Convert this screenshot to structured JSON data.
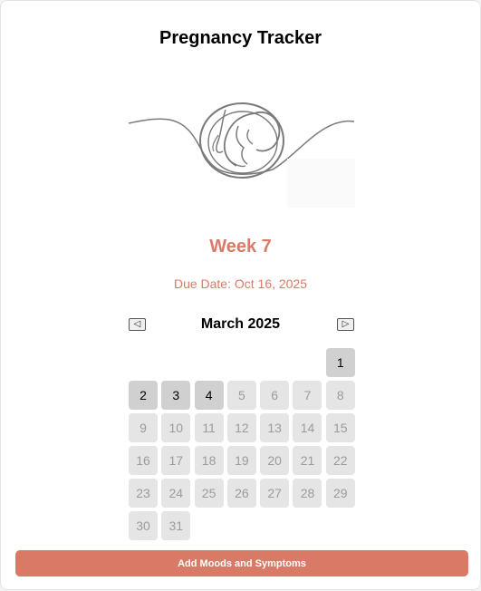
{
  "app": {
    "title": "Pregnancy Tracker"
  },
  "status": {
    "week_label": "Week 7",
    "due_date_label": "Due Date: Oct 16, 2025"
  },
  "calendar": {
    "month_label": "March 2025",
    "prev_icon": "triangle-left-icon",
    "next_icon": "triangle-right-icon",
    "leading_blanks": 6,
    "days": [
      {
        "label": "1",
        "active": true
      },
      {
        "label": "2",
        "active": true
      },
      {
        "label": "3",
        "active": true
      },
      {
        "label": "4",
        "active": true
      },
      {
        "label": "5",
        "active": false
      },
      {
        "label": "6",
        "active": false
      },
      {
        "label": "7",
        "active": false
      },
      {
        "label": "8",
        "active": false
      },
      {
        "label": "9",
        "active": false
      },
      {
        "label": "10",
        "active": false
      },
      {
        "label": "11",
        "active": false
      },
      {
        "label": "12",
        "active": false
      },
      {
        "label": "13",
        "active": false
      },
      {
        "label": "14",
        "active": false
      },
      {
        "label": "15",
        "active": false
      },
      {
        "label": "16",
        "active": false
      },
      {
        "label": "17",
        "active": false
      },
      {
        "label": "18",
        "active": false
      },
      {
        "label": "19",
        "active": false
      },
      {
        "label": "20",
        "active": false
      },
      {
        "label": "21",
        "active": false
      },
      {
        "label": "22",
        "active": false
      },
      {
        "label": "23",
        "active": false
      },
      {
        "label": "24",
        "active": false
      },
      {
        "label": "25",
        "active": false
      },
      {
        "label": "26",
        "active": false
      },
      {
        "label": "27",
        "active": false
      },
      {
        "label": "28",
        "active": false
      },
      {
        "label": "29",
        "active": false
      },
      {
        "label": "30",
        "active": false
      },
      {
        "label": "31",
        "active": false
      }
    ]
  },
  "actions": {
    "add_moods_label": "Add Moods and Symptoms"
  },
  "colors": {
    "accent": "#d97a66",
    "active_day": "#d0d0d0",
    "inactive_day": "#e5e5e5",
    "illustration_stroke": "#7a7a7a"
  }
}
